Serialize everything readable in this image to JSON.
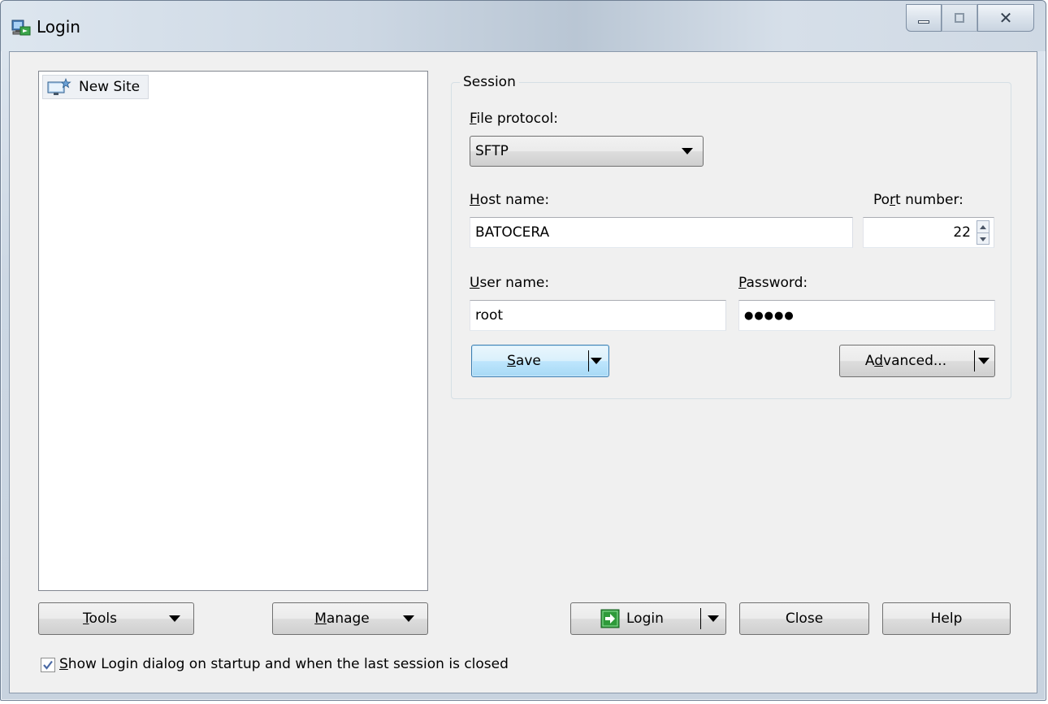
{
  "window": {
    "title": "Login",
    "caption_buttons": {
      "minimize_icon": "minimize-icon",
      "maximize_icon": "maximize-icon",
      "close_icon": "close-icon"
    }
  },
  "site_tree": {
    "items": [
      {
        "label": "New Site",
        "icon": "computer-star-icon"
      }
    ]
  },
  "session": {
    "group_label": "Session",
    "file_protocol": {
      "label_first": "F",
      "label_rest": "ile protocol:",
      "value": "SFTP"
    },
    "host_name": {
      "label_first": "H",
      "label_rest": "ost name:",
      "value": "BATOCERA"
    },
    "port_number": {
      "label_pre": "Po",
      "label_u": "r",
      "label_post": "t number:",
      "value": "22"
    },
    "user_name": {
      "label_first": "U",
      "label_rest": "ser name:",
      "value": "root"
    },
    "password": {
      "label_first": "P",
      "label_rest": "assword:",
      "value": "●●●●●"
    },
    "save_button": {
      "label_first": "S",
      "label_rest": "ave"
    },
    "advanced_button": {
      "label_pre": "A",
      "label_u": "d",
      "label_post": "vanced..."
    }
  },
  "bottom": {
    "tools_button": {
      "label_first": "T",
      "label_rest": "ools"
    },
    "manage_button": {
      "label_first": "M",
      "label_rest": "anage"
    },
    "login_button": {
      "label": "Login",
      "icon": "login-arrow-icon"
    },
    "close_button": {
      "label": "Close"
    },
    "help_button": {
      "label": "Help"
    },
    "show_login_checkbox": {
      "checked": true,
      "label_first": "S",
      "label_rest": "how Login dialog on startup and when the last session is closed"
    }
  },
  "colors": {
    "focus_button": "#bee6fd",
    "login_icon_green": "#2e9a3a"
  }
}
